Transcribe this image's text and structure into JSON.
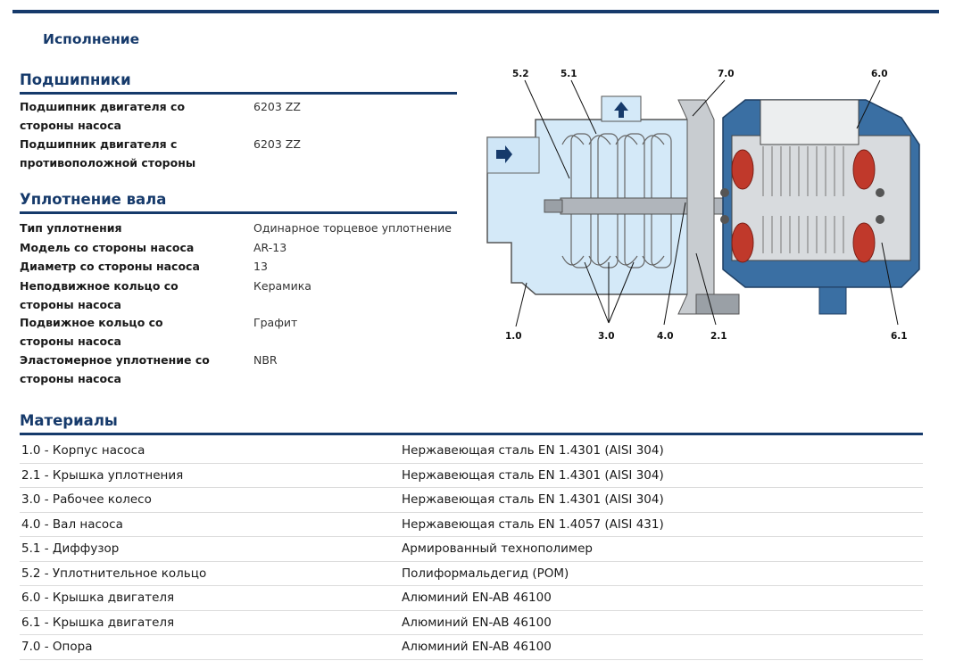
{
  "page_title": "Исполнение",
  "bearings": {
    "title": "Подшипники",
    "rows": [
      {
        "label": "Подшипник двигателя со стороны насоса",
        "value": "6203 ZZ"
      },
      {
        "label": "Подшипник двигателя с противоположной стороны",
        "value": "6203 ZZ"
      }
    ]
  },
  "shaft_seal": {
    "title": "Уплотнение вала",
    "rows": [
      {
        "label": "Тип уплотнения",
        "value": "Одинарное торцевое уплотнение"
      },
      {
        "label": "Модель со стороны насоса",
        "value": "AR-13"
      },
      {
        "label": "Диаметр со стороны насоса",
        "value": "13"
      },
      {
        "label": "Неподвижное кольцо со стороны насоса",
        "value": "Керамика"
      },
      {
        "label": "Подвижное кольцо со стороны насоса",
        "value": "Графит"
      },
      {
        "label": "Эластомерное уплотнение со стороны насоса",
        "value": "NBR"
      }
    ]
  },
  "materials": {
    "title": "Материалы",
    "rows": [
      {
        "part": "1.0 - Корпус насоса",
        "material": "Нержавеющая сталь EN 1.4301 (AISI 304)"
      },
      {
        "part": "2.1 - Крышка уплотнения",
        "material": "Нержавеющая сталь EN 1.4301 (AISI 304)"
      },
      {
        "part": "3.0 - Рабочее колесо",
        "material": "Нержавеющая сталь EN 1.4301 (AISI 304)"
      },
      {
        "part": "4.0 - Вал насоса",
        "material": "Нержавеющая сталь EN 1.4057 (AISI 431)"
      },
      {
        "part": "5.1 - Диффузор",
        "material": "Армированный технополимер"
      },
      {
        "part": "5.2 - Уплотнительное кольцо",
        "material": "Полиформальдегид (POM)"
      },
      {
        "part": "6.0 - Крышка двигателя",
        "material": "Алюминий EN-AB 46100"
      },
      {
        "part": "6.1 - Крышка двигателя",
        "material": "Алюминий EN-AB 46100"
      },
      {
        "part": "7.0 - Опора",
        "material": "Алюминий EN-AB 46100"
      }
    ]
  },
  "diagram": {
    "callouts": [
      "5.2",
      "5.1",
      "7.0",
      "6.0",
      "1.0",
      "3.0",
      "4.0",
      "2.1",
      "6.1"
    ],
    "colors": {
      "pump_body": "#cfe6f7",
      "motor_blue": "#3a6fa3",
      "steel": "#a9aeb4",
      "copper": "#c0392b"
    }
  }
}
